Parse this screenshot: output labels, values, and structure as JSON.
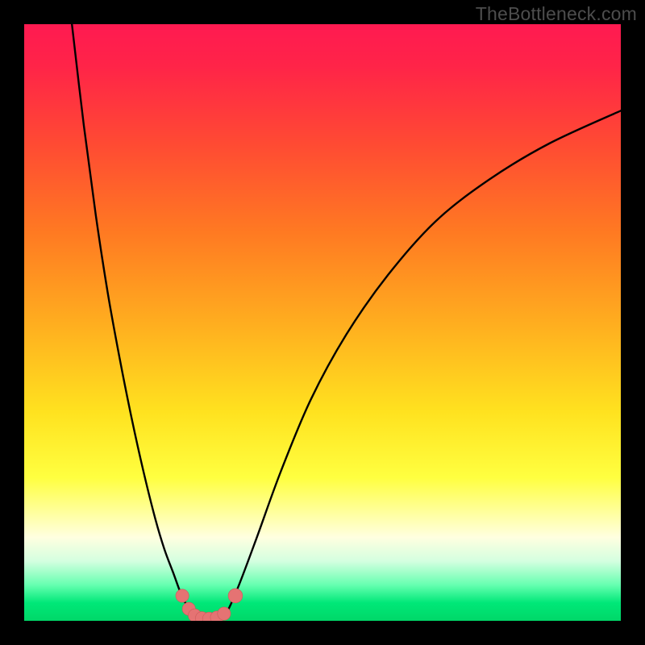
{
  "watermark": "TheBottleneck.com",
  "colors": {
    "frame": "#000000",
    "watermark": "#4d4d4d",
    "curve": "#000000",
    "marker_fill": "#e57373",
    "marker_stroke": "#cc5b5b"
  },
  "gradient_stops": [
    {
      "offset": 0.0,
      "color": "#ff1a51"
    },
    {
      "offset": 0.07,
      "color": "#ff2448"
    },
    {
      "offset": 0.2,
      "color": "#ff4a33"
    },
    {
      "offset": 0.35,
      "color": "#ff7a22"
    },
    {
      "offset": 0.5,
      "color": "#ffad1f"
    },
    {
      "offset": 0.65,
      "color": "#ffe21f"
    },
    {
      "offset": 0.76,
      "color": "#ffff40"
    },
    {
      "offset": 0.82,
      "color": "#ffffa0"
    },
    {
      "offset": 0.86,
      "color": "#ffffe0"
    },
    {
      "offset": 0.9,
      "color": "#d4ffe0"
    },
    {
      "offset": 0.94,
      "color": "#66ffb0"
    },
    {
      "offset": 0.97,
      "color": "#00e878"
    },
    {
      "offset": 1.0,
      "color": "#00d768"
    }
  ],
  "chart_data": {
    "type": "line",
    "title": "",
    "xlabel": "",
    "ylabel": "",
    "xlim": [
      0,
      100
    ],
    "ylim": [
      0,
      100
    ],
    "left_curve": {
      "name": "left-branch",
      "x": [
        8,
        10,
        12,
        14,
        16,
        18,
        20,
        22,
        23.5,
        25,
        26.5,
        28
      ],
      "y": [
        100,
        83,
        68,
        55,
        44,
        34,
        25,
        17,
        12,
        8,
        4,
        1.5
      ]
    },
    "right_curve": {
      "name": "right-branch",
      "x": [
        34,
        36,
        39,
        43,
        48,
        54,
        61,
        69,
        78,
        88,
        100
      ],
      "y": [
        1.5,
        6,
        14,
        25,
        37,
        48,
        58,
        67,
        74,
        80,
        85.5
      ]
    },
    "trough": {
      "name": "trough",
      "x": [
        28,
        29,
        30,
        31,
        32,
        33,
        34
      ],
      "y": [
        1.5,
        0.7,
        0.4,
        0.3,
        0.4,
        0.7,
        1.5
      ]
    },
    "markers": [
      {
        "x": 26.5,
        "y": 4.2,
        "r": 1.1
      },
      {
        "x": 27.6,
        "y": 2.0,
        "r": 1.1
      },
      {
        "x": 28.6,
        "y": 0.9,
        "r": 1.1
      },
      {
        "x": 29.8,
        "y": 0.45,
        "r": 1.1
      },
      {
        "x": 31.0,
        "y": 0.35,
        "r": 1.1
      },
      {
        "x": 32.3,
        "y": 0.55,
        "r": 1.1
      },
      {
        "x": 33.5,
        "y": 1.2,
        "r": 1.1
      },
      {
        "x": 35.4,
        "y": 4.2,
        "r": 1.2
      }
    ]
  }
}
